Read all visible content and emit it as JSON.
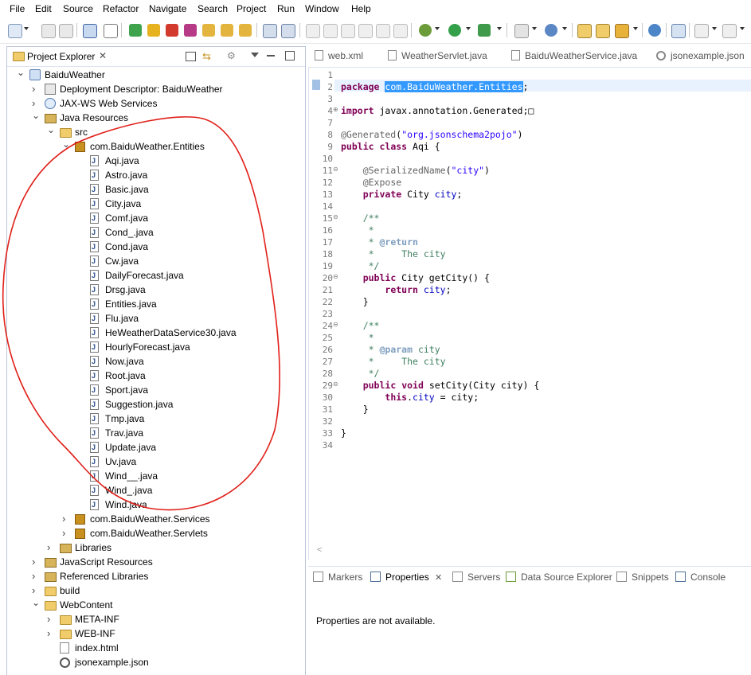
{
  "menu": [
    "File",
    "Edit",
    "Source",
    "Refactor",
    "Navigate",
    "Search",
    "Project",
    "Run",
    "Window",
    "Help"
  ],
  "project_explorer": {
    "title": "Project Explorer",
    "tree": [
      {
        "label": "BaiduWeather",
        "depth": 0,
        "icon": "project-icon",
        "expanded": true
      },
      {
        "label": "Deployment Descriptor: BaiduWeather",
        "depth": 1,
        "icon": "descriptor-icon",
        "expanded": false
      },
      {
        "label": "JAX-WS Web Services",
        "depth": 1,
        "icon": "webservice-icon",
        "expanded": false
      },
      {
        "label": "Java Resources",
        "depth": 1,
        "icon": "java-resources-icon",
        "expanded": true
      },
      {
        "label": "src",
        "depth": 2,
        "icon": "source-folder-icon",
        "expanded": true
      },
      {
        "label": "com.BaiduWeather.Entities",
        "depth": 3,
        "icon": "package-icon",
        "expanded": true
      },
      {
        "label": "Aqi.java",
        "depth": 4,
        "icon": "java-file-icon"
      },
      {
        "label": "Astro.java",
        "depth": 4,
        "icon": "java-file-icon"
      },
      {
        "label": "Basic.java",
        "depth": 4,
        "icon": "java-file-icon"
      },
      {
        "label": "City.java",
        "depth": 4,
        "icon": "java-file-icon"
      },
      {
        "label": "Comf.java",
        "depth": 4,
        "icon": "java-file-icon"
      },
      {
        "label": "Cond_.java",
        "depth": 4,
        "icon": "java-file-icon"
      },
      {
        "label": "Cond.java",
        "depth": 4,
        "icon": "java-file-icon"
      },
      {
        "label": "Cw.java",
        "depth": 4,
        "icon": "java-file-icon"
      },
      {
        "label": "DailyForecast.java",
        "depth": 4,
        "icon": "java-file-icon"
      },
      {
        "label": "Drsg.java",
        "depth": 4,
        "icon": "java-file-icon"
      },
      {
        "label": "Entities.java",
        "depth": 4,
        "icon": "java-file-icon"
      },
      {
        "label": "Flu.java",
        "depth": 4,
        "icon": "java-file-icon"
      },
      {
        "label": "HeWeatherDataService30.java",
        "depth": 4,
        "icon": "java-file-icon"
      },
      {
        "label": "HourlyForecast.java",
        "depth": 4,
        "icon": "java-file-icon"
      },
      {
        "label": "Now.java",
        "depth": 4,
        "icon": "java-file-icon"
      },
      {
        "label": "Root.java",
        "depth": 4,
        "icon": "java-file-icon"
      },
      {
        "label": "Sport.java",
        "depth": 4,
        "icon": "java-file-icon"
      },
      {
        "label": "Suggestion.java",
        "depth": 4,
        "icon": "java-file-icon"
      },
      {
        "label": "Tmp.java",
        "depth": 4,
        "icon": "java-file-icon"
      },
      {
        "label": "Trav.java",
        "depth": 4,
        "icon": "java-file-icon"
      },
      {
        "label": "Update.java",
        "depth": 4,
        "icon": "java-file-icon"
      },
      {
        "label": "Uv.java",
        "depth": 4,
        "icon": "java-file-icon"
      },
      {
        "label": "Wind__.java",
        "depth": 4,
        "icon": "java-file-icon"
      },
      {
        "label": "Wind_.java",
        "depth": 4,
        "icon": "java-file-icon"
      },
      {
        "label": "Wind.java",
        "depth": 4,
        "icon": "java-file-icon"
      },
      {
        "label": "com.BaiduWeather.Services",
        "depth": 3,
        "icon": "package-icon",
        "expanded": false
      },
      {
        "label": "com.BaiduWeather.Servlets",
        "depth": 3,
        "icon": "package-icon",
        "expanded": false
      },
      {
        "label": "Libraries",
        "depth": 2,
        "icon": "library-icon",
        "expanded": false
      },
      {
        "label": "JavaScript Resources",
        "depth": 1,
        "icon": "library-icon",
        "expanded": false
      },
      {
        "label": "Referenced Libraries",
        "depth": 1,
        "icon": "library-icon",
        "expanded": false
      },
      {
        "label": "build",
        "depth": 1,
        "icon": "folder-icon",
        "expanded": false
      },
      {
        "label": "WebContent",
        "depth": 1,
        "icon": "folder-icon",
        "expanded": true
      },
      {
        "label": "META-INF",
        "depth": 2,
        "icon": "folder-icon",
        "expanded": false
      },
      {
        "label": "WEB-INF",
        "depth": 2,
        "icon": "folder-icon",
        "expanded": false
      },
      {
        "label": "index.html",
        "depth": 2,
        "icon": "html-file-icon"
      },
      {
        "label": "jsonexample.json",
        "depth": 2,
        "icon": "json-file-icon"
      }
    ]
  },
  "editor": {
    "tabs": [
      "web.xml",
      "WeatherServlet.java",
      "BaiduWeatherService.java",
      "jsonexample.json"
    ],
    "lines": [
      {
        "n": "1",
        "html": ""
      },
      {
        "n": "2",
        "html": "<span class='kw'>package</span> <span class='sel'>com.BaiduWeather.Entities</span>;"
      },
      {
        "n": "3",
        "html": ""
      },
      {
        "n": "4",
        "html": "<span class='kw'>import</span> javax.annotation.Generated;&#9633;"
      },
      {
        "n": "7",
        "html": ""
      },
      {
        "n": "8",
        "html": "<span class='ann'>@Generated</span>(<span class='str'>\"org.jsonschema2pojo\"</span>)"
      },
      {
        "n": "9",
        "html": "<span class='kw'>public</span> <span class='kw'>class</span> Aqi {"
      },
      {
        "n": "10",
        "html": ""
      },
      {
        "n": "11",
        "html": "    <span class='ann'>@SerializedName</span>(<span class='str'>\"city\"</span>)"
      },
      {
        "n": "12",
        "html": "    <span class='ann'>@Expose</span>"
      },
      {
        "n": "13",
        "html": "    <span class='kw'>private</span> City <span class='fld'>city</span>;"
      },
      {
        "n": "14",
        "html": ""
      },
      {
        "n": "15",
        "html": "    <span class='cmt'>/**</span>"
      },
      {
        "n": "16",
        "html": "     <span class='cmt'>*</span>"
      },
      {
        "n": "17",
        "html": "     <span class='cmt'>* </span><span class='tag'>@return</span>"
      },
      {
        "n": "18",
        "html": "     <span class='cmt'>*     The city</span>"
      },
      {
        "n": "19",
        "html": "     <span class='cmt'>*/</span>"
      },
      {
        "n": "20",
        "html": "    <span class='kw'>public</span> City getCity() {"
      },
      {
        "n": "21",
        "html": "        <span class='kw'>return</span> <span class='fld'>city</span>;"
      },
      {
        "n": "22",
        "html": "    }"
      },
      {
        "n": "23",
        "html": ""
      },
      {
        "n": "24",
        "html": "    <span class='cmt'>/**</span>"
      },
      {
        "n": "25",
        "html": "     <span class='cmt'>*</span>"
      },
      {
        "n": "26",
        "html": "     <span class='cmt'>* </span><span class='tag'>@param</span> <span class='cmt'>city</span>"
      },
      {
        "n": "27",
        "html": "     <span class='cmt'>*     The city</span>"
      },
      {
        "n": "28",
        "html": "     <span class='cmt'>*/</span>"
      },
      {
        "n": "29",
        "html": "    <span class='kw'>public</span> <span class='kw'>void</span> setCity(City city) {"
      },
      {
        "n": "30",
        "html": "        <span class='kw'>this</span>.<span class='fld'>city</span> = city;"
      },
      {
        "n": "31",
        "html": "    }"
      },
      {
        "n": "32",
        "html": ""
      },
      {
        "n": "33",
        "html": "}"
      },
      {
        "n": "34",
        "html": ""
      }
    ]
  },
  "bottom_panel": {
    "tabs": [
      "Markers",
      "Properties",
      "Servers",
      "Data Source Explorer",
      "Snippets",
      "Console"
    ],
    "active": "Properties",
    "message": "Properties are not available."
  },
  "colors": {
    "annotation_circle": "#e0201a",
    "selection": "#3399ff",
    "keyword": "#7f0055"
  }
}
